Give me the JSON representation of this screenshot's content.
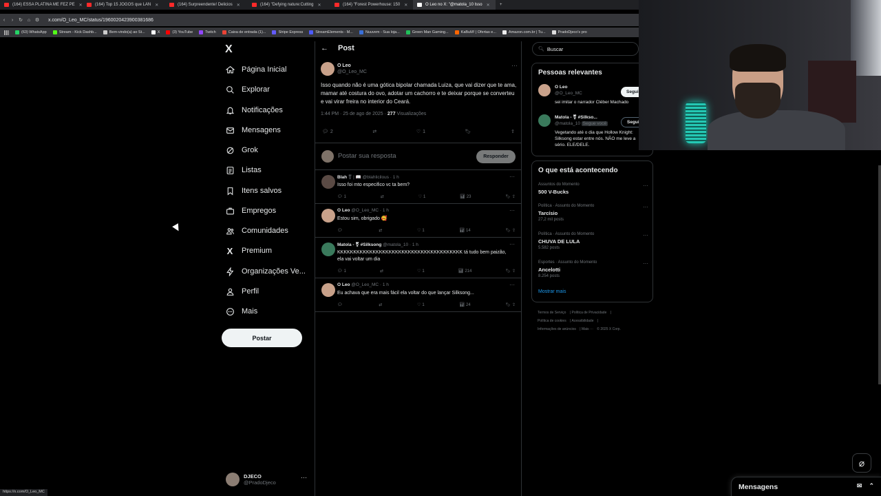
{
  "browser": {
    "tabs": [
      {
        "title": "(164) ESSA PLATINA ME FEZ PE",
        "active": false
      },
      {
        "title": "(164) Top 15 JOGOS que LAN",
        "active": false
      },
      {
        "title": "(164) Surpreendente! Delicios",
        "active": false
      },
      {
        "title": "(164) \"Defying nature:Cutting",
        "active": false
      },
      {
        "title": "(164) \"Forest Powerhouse: 150",
        "active": false
      },
      {
        "title": "O Leo no X: \"@matola_10 Isso",
        "active": true
      }
    ],
    "url": "x.com/O_Leo_MC/status/1960020423900381686",
    "bookmarks": [
      "(63) WhatsApp",
      "Stream - Kick Dashb...",
      "Bem-vindo(a) ao St...",
      "X",
      "(3) YouTube",
      "Twitch",
      "Caixa de entrada (1)...",
      "Stripe Express",
      "StreamElements - M...",
      "Nuuvem - Sua loja...",
      "Green Man Gaming...",
      "KaBuM! | Ofertas e...",
      "Amazon.com.br | Tu...",
      "PradoDjeco's pro"
    ],
    "status_url": "https://x.com/O_Leo_MC"
  },
  "nav": {
    "logo": "X",
    "items": [
      {
        "label": "Página Inicial",
        "icon": "home-icon"
      },
      {
        "label": "Explorar",
        "icon": "search-icon"
      },
      {
        "label": "Notificações",
        "icon": "bell-icon"
      },
      {
        "label": "Mensagens",
        "icon": "mail-icon"
      },
      {
        "label": "Grok",
        "icon": "grok-icon"
      },
      {
        "label": "Listas",
        "icon": "list-icon"
      },
      {
        "label": "Itens salvos",
        "icon": "bookmark-icon"
      },
      {
        "label": "Empregos",
        "icon": "briefcase-icon"
      },
      {
        "label": "Comunidades",
        "icon": "people-icon"
      },
      {
        "label": "Premium",
        "icon": "x-icon"
      },
      {
        "label": "Organizações Ve...",
        "icon": "bolt-icon"
      },
      {
        "label": "Perfil",
        "icon": "person-icon"
      },
      {
        "label": "Mais",
        "icon": "more-icon"
      }
    ],
    "post_button": "Postar",
    "account": {
      "name": "DJECO",
      "handle": "@PradoDjeco",
      "more": "···"
    }
  },
  "post": {
    "header": "Post",
    "author": "O Leo",
    "handle": "@O_Leo_MC",
    "text": "Isso quando não é uma gótica bipolar chamada Luiza, que vai dizer que te ama, mamar até costura do ovo, adotar um cachorro e te deixar porque se converteu e vai virar freira no interior do Ceará.",
    "time": "1:44 PM · 25 de ago de 2025 · ",
    "views": "277",
    "views_label": " Visualizações",
    "replies": "2",
    "likes": "1",
    "reply_placeholder": "Postar sua resposta",
    "reply_button": "Responder"
  },
  "replies": [
    {
      "name": "Blah",
      "handle": "⚧ | 📖 @blahlicilous · 1 h",
      "text": "Isso foi mto especifico vc ta bem?",
      "replies": "1",
      "likes": "1",
      "views": "23",
      "avatar": "#5a4a44"
    },
    {
      "name": "O Leo",
      "handle": "@O_Leo_MC · 1 h",
      "text": "Estou sim, obrigado 🥰",
      "replies": "",
      "likes": "1",
      "views": "14",
      "avatar": "#c8a18a"
    },
    {
      "name": "Matola - ⚧ #Silksong",
      "handle": "@matola_10 · 1 h",
      "text": "KKKKKKKKKKKKKKKKKKKKKKKKKKKKKKKKKKKKKKK tá tudo bem paizão, ela vai voltar um dia",
      "replies": "1",
      "likes": "1",
      "views": "214",
      "avatar": "#3a7a5c"
    },
    {
      "name": "O Leo",
      "handle": "@O_Leo_MC · 1 h",
      "text": "Eu achava que era mais fácil ela voltar do que lançar Silksong...",
      "replies": "",
      "likes": "1",
      "views": "24",
      "avatar": "#c8a18a"
    }
  ],
  "sidebar": {
    "search_placeholder": "Buscar",
    "relevant_title": "Pessoas relevantes",
    "people": [
      {
        "name": "O Leo",
        "handle": "@O_Leo_MC",
        "bio": "sei imitar o narrador Cléber Machado",
        "button": "Seguir",
        "avatar": "#c8a18a"
      },
      {
        "name": "Matola - ⚧ #Silkso...",
        "handle": "@matola_10",
        "badge": "Segue você",
        "bio": "Vegetando até o dia que Hollow Knight: Silksong estar entre nós. NÃO me leve a sério. ELE/DELE.",
        "button": "Seguindo",
        "avatar": "#3a7a5c"
      }
    ],
    "trends_title": "O que está acontecendo",
    "trends": [
      {
        "category": "Assuntos do Momento",
        "name": "500 V-Bucks",
        "count": ""
      },
      {
        "category": "Política · Assunto do Momento",
        "name": "Tarcísio",
        "count": "27,2 mil posts"
      },
      {
        "category": "Política · Assunto do Momento",
        "name": "CHUVA DE LULA",
        "count": "5.582 posts"
      },
      {
        "category": "Esportes · Assunto do Momento",
        "name": "Ancelotti",
        "count": "8.254 posts"
      }
    ],
    "show_more": "Mostrar mais",
    "footer": [
      "Termos de Serviço",
      "Política de Privacidade",
      "Política de cookies",
      "Acessibilidade",
      "Informações de anúncios",
      "Mais ···",
      "© 2025 X Corp."
    ]
  },
  "dock": {
    "title": "Mensagens"
  }
}
